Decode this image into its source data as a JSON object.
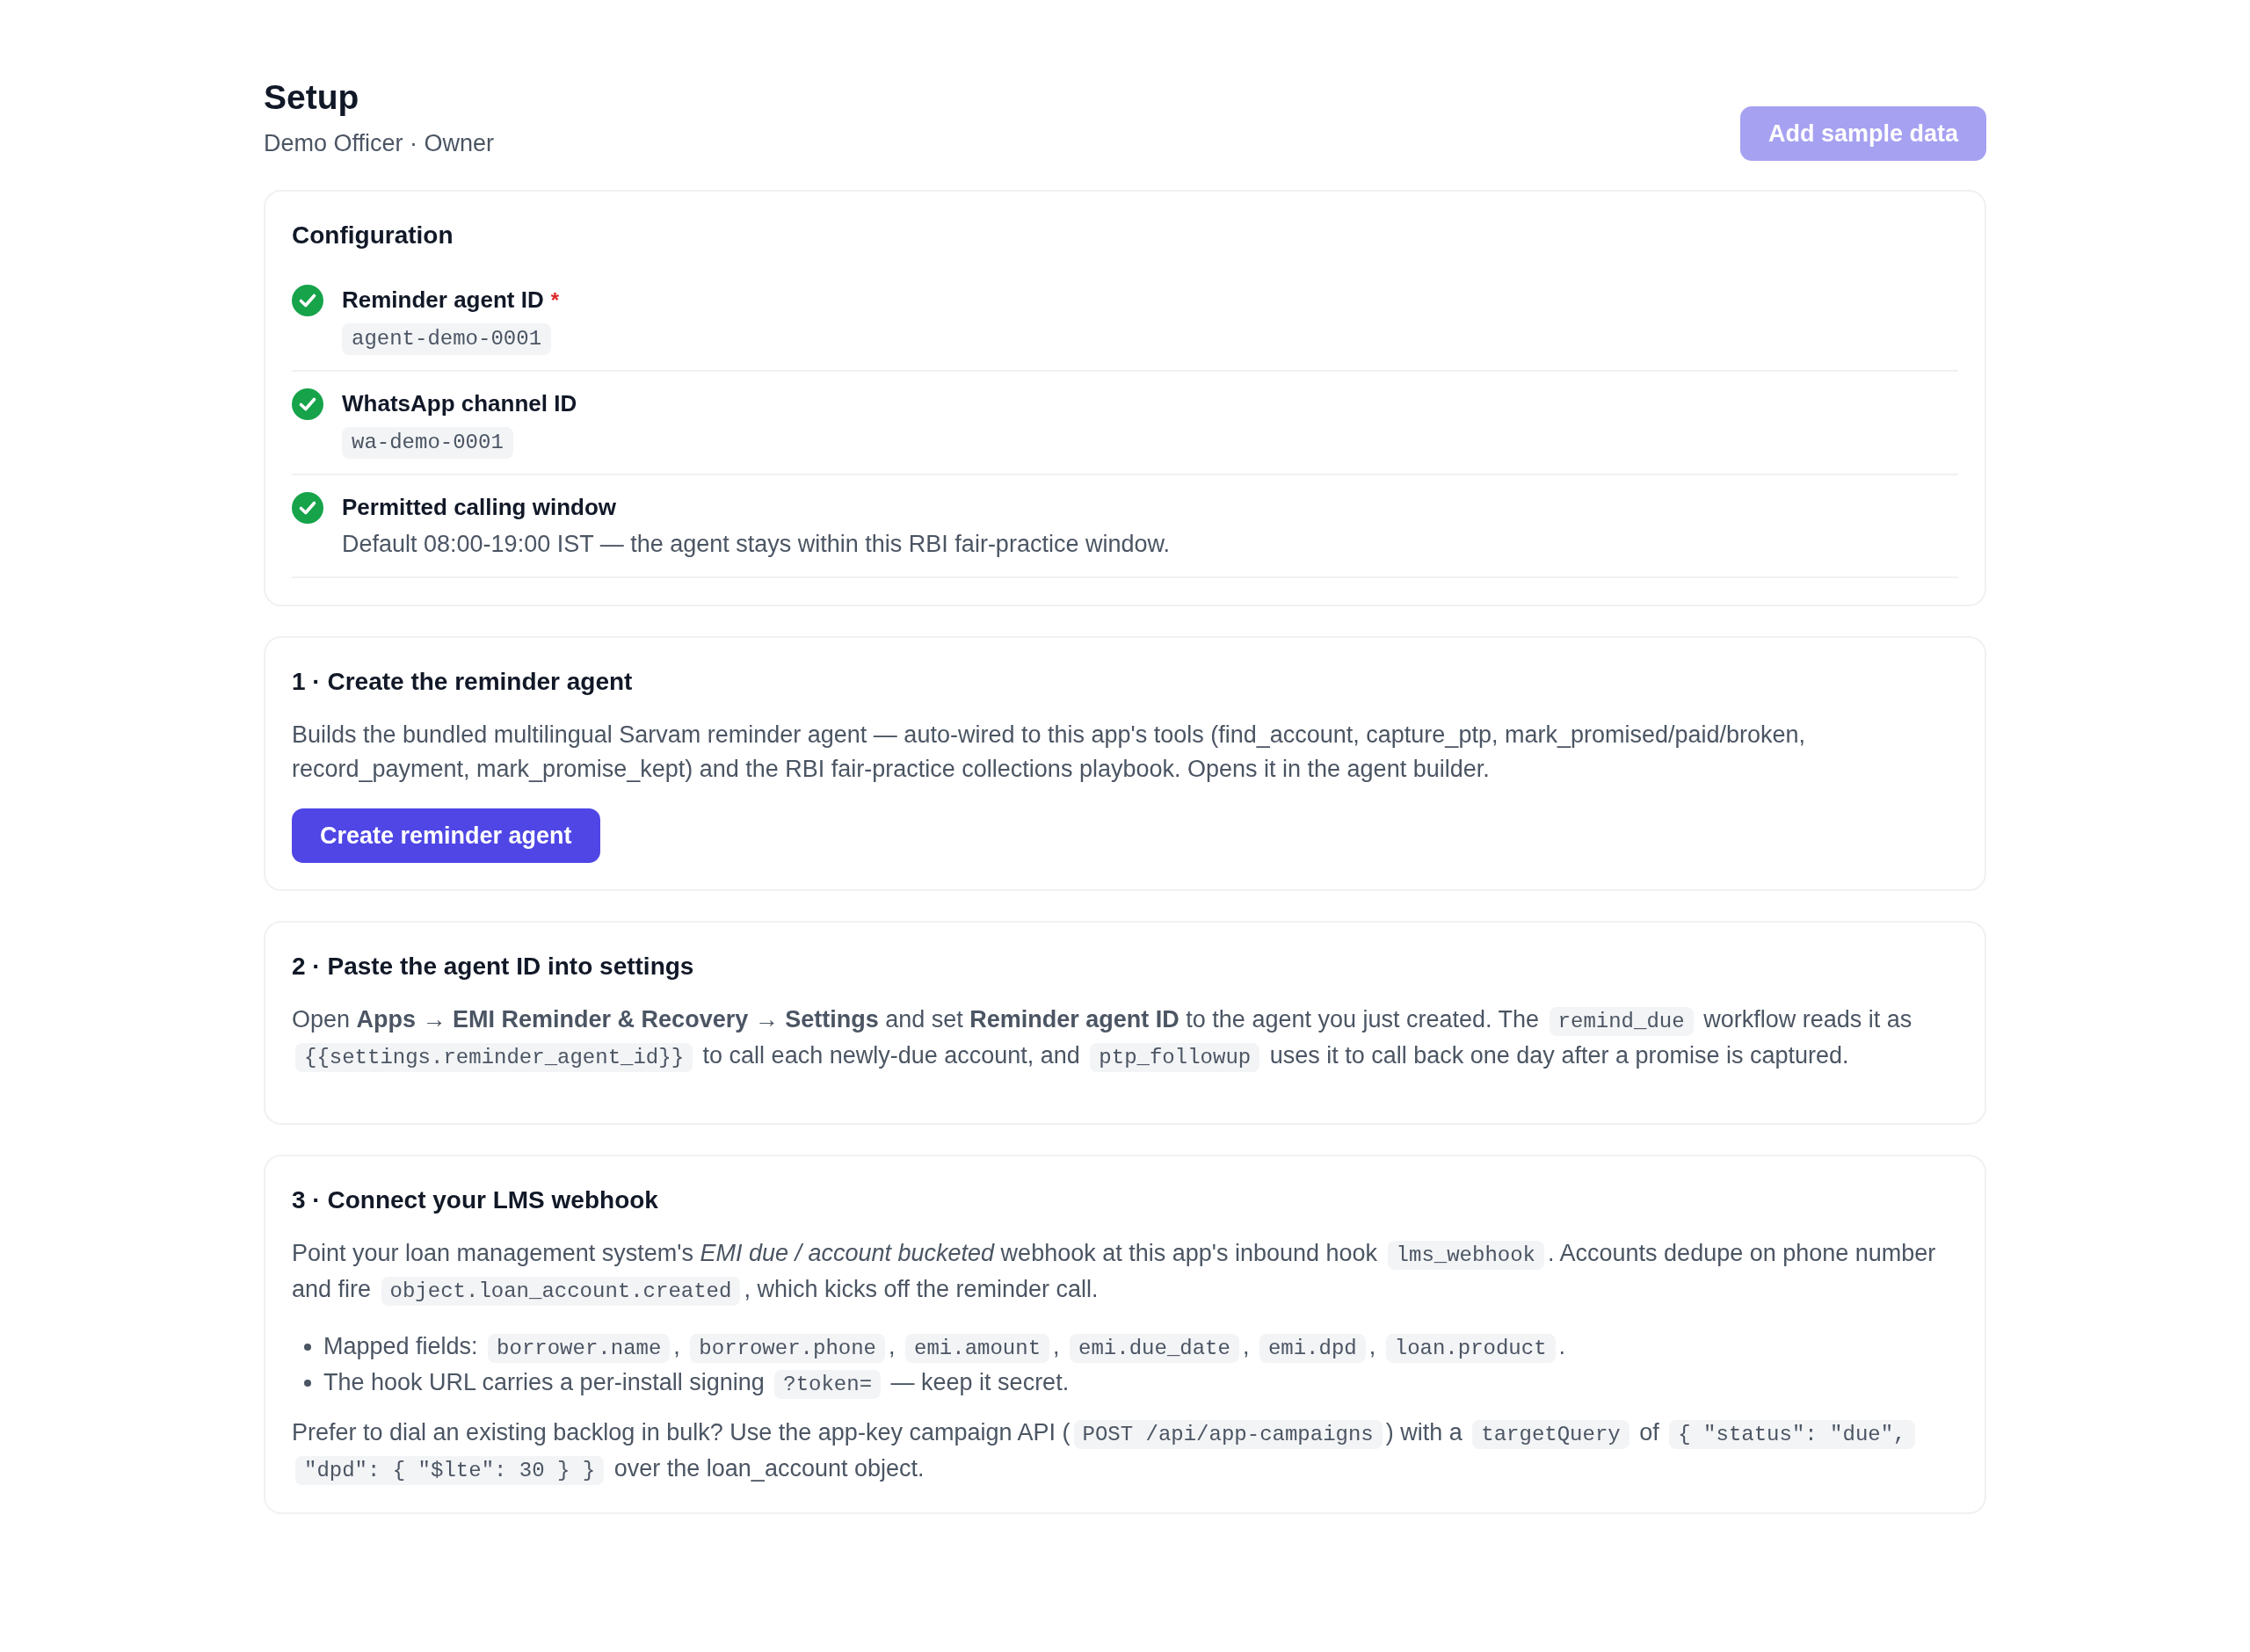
{
  "header": {
    "title": "Setup",
    "subtitle": "Demo Officer · Owner",
    "button": {
      "label": "Add sample data",
      "disabled": true
    }
  },
  "configuration": {
    "title": "Configuration",
    "items": [
      {
        "kind": "code",
        "label": "Reminder agent ID",
        "required_mark": "*",
        "checked": true,
        "detail": "agent-demo-0001"
      },
      {
        "kind": "code",
        "label": "WhatsApp channel ID",
        "checked": true,
        "detail": "wa-demo-0001"
      },
      {
        "kind": "note",
        "label": "Permitted calling window",
        "checked": true,
        "detail": "Default 08:00-19:00 IST — the agent stays within this RBI fair-practice window."
      }
    ]
  },
  "steps": [
    {
      "title": "1 · Create the reminder agent",
      "blocks": [
        {
          "kind": "paragraph",
          "parts": [
            {
              "kind": "text",
              "text": "Builds the bundled multilingual Sarvam reminder agent — auto-wired to this app's tools (find_account, capture_ptp, mark_promised/paid/broken, record_payment, mark_promise_kept) and the RBI fair-practice collections playbook. Opens it in the agent builder."
            }
          ]
        },
        {
          "kind": "button",
          "label": "Create reminder agent",
          "disabled": false
        }
      ]
    },
    {
      "title": "2 · Paste the agent ID into settings",
      "blocks": [
        {
          "kind": "paragraph",
          "parts": [
            {
              "kind": "text",
              "text": "Open **Apps → EMI Reminder & Recovery → Settings** and set **Reminder agent ID** to the agent you just created. The "
            },
            {
              "kind": "code",
              "text": "remind_due"
            },
            {
              "kind": "text",
              "text": " workflow reads it as "
            },
            {
              "kind": "code",
              "text": "{{settings.reminder_agent_id}}"
            },
            {
              "kind": "text",
              "text": " to call each newly-due account, and "
            },
            {
              "kind": "code",
              "text": "ptp_followup"
            },
            {
              "kind": "text",
              "text": " uses it to call back one day after a promise is captured."
            }
          ]
        }
      ]
    },
    {
      "title": "3 · Connect your LMS webhook",
      "blocks": [
        {
          "kind": "paragraph",
          "parts": [
            {
              "kind": "text",
              "text": "Point your loan management system's *EMI due / account bucketed* webhook at this app's inbound hook "
            },
            {
              "kind": "code",
              "text": "lms_webhook"
            },
            {
              "kind": "text",
              "text": ". Accounts dedupe on phone number and fire "
            },
            {
              "kind": "code",
              "text": "object.loan_account.created"
            },
            {
              "kind": "text",
              "text": ", which kicks off the reminder call."
            }
          ]
        },
        {
          "kind": "bullets",
          "items": [
            {
              "parts": [
                {
                  "kind": "text",
                  "text": "Mapped fields: "
                },
                {
                  "kind": "code",
                  "text": "borrower.name"
                },
                {
                  "kind": "text",
                  "text": ", "
                },
                {
                  "kind": "code",
                  "text": "borrower.phone"
                },
                {
                  "kind": "text",
                  "text": ", "
                },
                {
                  "kind": "code",
                  "text": "emi.amount"
                },
                {
                  "kind": "text",
                  "text": ", "
                },
                {
                  "kind": "code",
                  "text": "emi.due_date"
                },
                {
                  "kind": "text",
                  "text": ", "
                },
                {
                  "kind": "code",
                  "text": "emi.dpd"
                },
                {
                  "kind": "text",
                  "text": ", "
                },
                {
                  "kind": "code",
                  "text": "loan.product"
                },
                {
                  "kind": "text",
                  "text": "."
                }
              ]
            },
            {
              "parts": [
                {
                  "kind": "text",
                  "text": "The hook URL carries a per-install signing "
                },
                {
                  "kind": "code",
                  "text": "?token="
                },
                {
                  "kind": "text",
                  "text": " — keep it secret."
                }
              ]
            }
          ]
        },
        {
          "kind": "paragraph",
          "parts": [
            {
              "kind": "text",
              "text": "Prefer to dial an existing backlog in bulk? Use the app-key campaign API ("
            },
            {
              "kind": "code",
              "text": "POST /api/app-campaigns"
            },
            {
              "kind": "text",
              "text": ") with a "
            },
            {
              "kind": "code",
              "text": "targetQuery"
            },
            {
              "kind": "text",
              "text": " of "
            },
            {
              "kind": "code",
              "text": "{ \"status\": \"due\", \"dpd\": { \"$lte\": 30 } }"
            },
            {
              "kind": "text",
              "text": " over the loan_account object."
            }
          ]
        }
      ]
    }
  ]
}
